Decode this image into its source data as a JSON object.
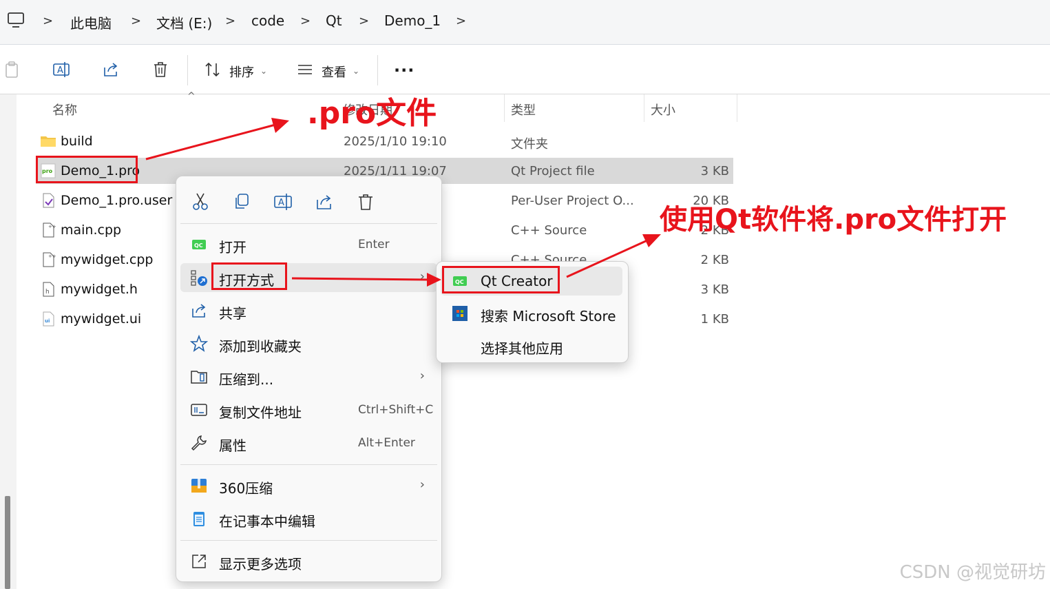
{
  "address_bar": {
    "crumbs": [
      "此电脑",
      "文档 (E:)",
      "code",
      "Qt",
      "Demo_1"
    ],
    "separator": ">"
  },
  "toolbar": {
    "sort_label": "排序",
    "view_label": "查看",
    "more_label": "..."
  },
  "columns": {
    "name": "名称",
    "date": "修改日期",
    "type": "类型",
    "size": "大小"
  },
  "files": [
    {
      "name": "build",
      "date": "2025/1/10 19:10",
      "type": "文件夹",
      "size": "",
      "icon": "folder-icon"
    },
    {
      "name": "Demo_1.pro",
      "date": "2025/1/11 19:07",
      "type": "Qt Project file",
      "size": "3 KB",
      "icon": "qt-pro-file-icon"
    },
    {
      "name": "Demo_1.pro.user",
      "date": "",
      "type": "Per-User Project O...",
      "size": "20 KB",
      "icon": "vs-file-icon"
    },
    {
      "name": "main.cpp",
      "date": "",
      "type": "C++ Source",
      "size": "2 KB",
      "icon": "cpp-file-icon"
    },
    {
      "name": "mywidget.cpp",
      "date": "",
      "type": "C++ Source",
      "size": "2 KB",
      "icon": "cpp-file-icon"
    },
    {
      "name": "mywidget.h",
      "date": "",
      "type": "",
      "size": "3 KB",
      "icon": "header-file-icon"
    },
    {
      "name": "mywidget.ui",
      "date": "",
      "type": "",
      "size": "1 KB",
      "icon": "ui-file-icon"
    }
  ],
  "context_menu": {
    "open": {
      "label": "打开",
      "shortcut": "Enter"
    },
    "open_with": {
      "label": "打开方式"
    },
    "share": {
      "label": "共享"
    },
    "add_favorite": {
      "label": "添加到收藏夹"
    },
    "compress": {
      "label": "压缩到..."
    },
    "copy_path": {
      "label": "复制文件地址",
      "shortcut": "Ctrl+Shift+C"
    },
    "properties": {
      "label": "属性",
      "shortcut": "Alt+Enter"
    },
    "zip360": {
      "label": "360压缩"
    },
    "notepad": {
      "label": "在记事本中编辑"
    },
    "more_options": {
      "label": "显示更多选项"
    }
  },
  "submenu": {
    "qt_creator": "Qt Creator",
    "ms_store": "搜索 Microsoft Store",
    "other_app": "选择其他应用"
  },
  "annotations": {
    "pro_file": ".pro文件",
    "open_with_qt": "使用Qt软件将.pro文件打开",
    "color": "#e8141c"
  },
  "watermark": "CSDN @视觉研坊"
}
